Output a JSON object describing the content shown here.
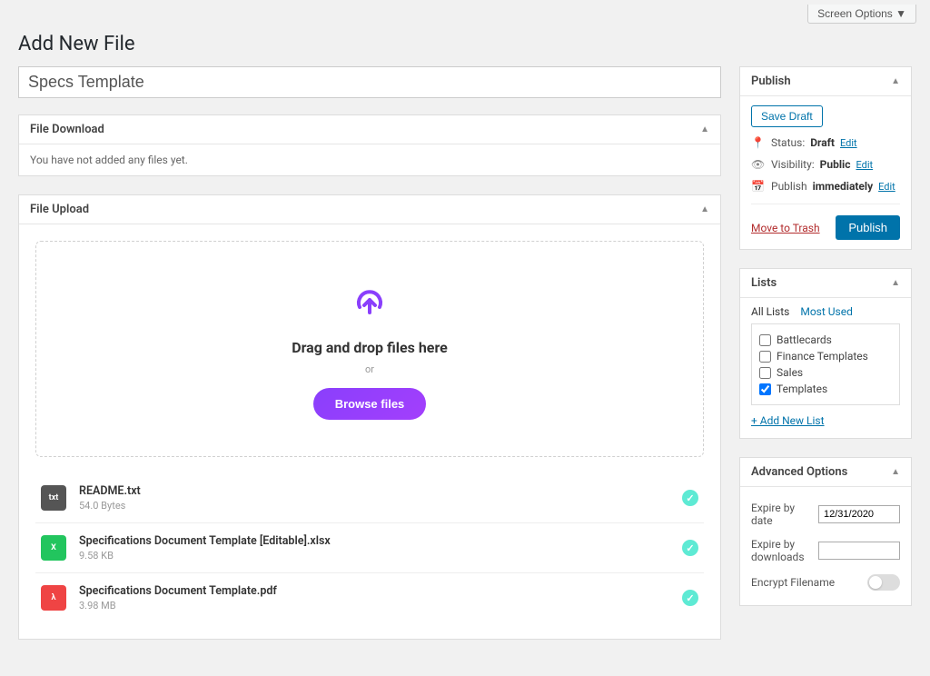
{
  "screen_options": "Screen Options ▼",
  "page_title": "Add New File",
  "title_value": "Specs Template",
  "file_download": {
    "heading": "File Download",
    "empty_msg": "You have not added any files yet."
  },
  "file_upload": {
    "heading": "File Upload",
    "drop_heading": "Drag and drop files here",
    "or": "or",
    "browse": "Browse files",
    "files": [
      {
        "name": "README.txt",
        "size": "54.0 Bytes",
        "type": "txt",
        "icon_label": "txt"
      },
      {
        "name": "Specifications Document Template [Editable].xlsx",
        "size": "9.58 KB",
        "type": "xls",
        "icon_label": "X"
      },
      {
        "name": "Specifications Document Template.pdf",
        "size": "3.98 MB",
        "type": "pdf",
        "icon_label": "λ"
      }
    ]
  },
  "publish": {
    "heading": "Publish",
    "save_draft": "Save Draft",
    "status_label": "Status:",
    "status_value": "Draft",
    "status_edit": "Edit",
    "visibility_label": "Visibility:",
    "visibility_value": "Public",
    "visibility_edit": "Edit",
    "schedule_label": "Publish",
    "schedule_value": "immediately",
    "schedule_edit": "Edit",
    "trash": "Move to Trash",
    "publish_btn": "Publish"
  },
  "lists": {
    "heading": "Lists",
    "tabs": [
      "All Lists",
      "Most Used"
    ],
    "items": [
      {
        "label": "Battlecards",
        "checked": false
      },
      {
        "label": "Finance Templates",
        "checked": false
      },
      {
        "label": "Sales",
        "checked": false
      },
      {
        "label": "Templates",
        "checked": true
      }
    ],
    "add_new": "+ Add New List"
  },
  "advanced": {
    "heading": "Advanced Options",
    "expire_date_label": "Expire by date",
    "expire_date_value": "12/31/2020",
    "expire_downloads_label": "Expire by downloads",
    "encrypt_label": "Encrypt Filename"
  }
}
